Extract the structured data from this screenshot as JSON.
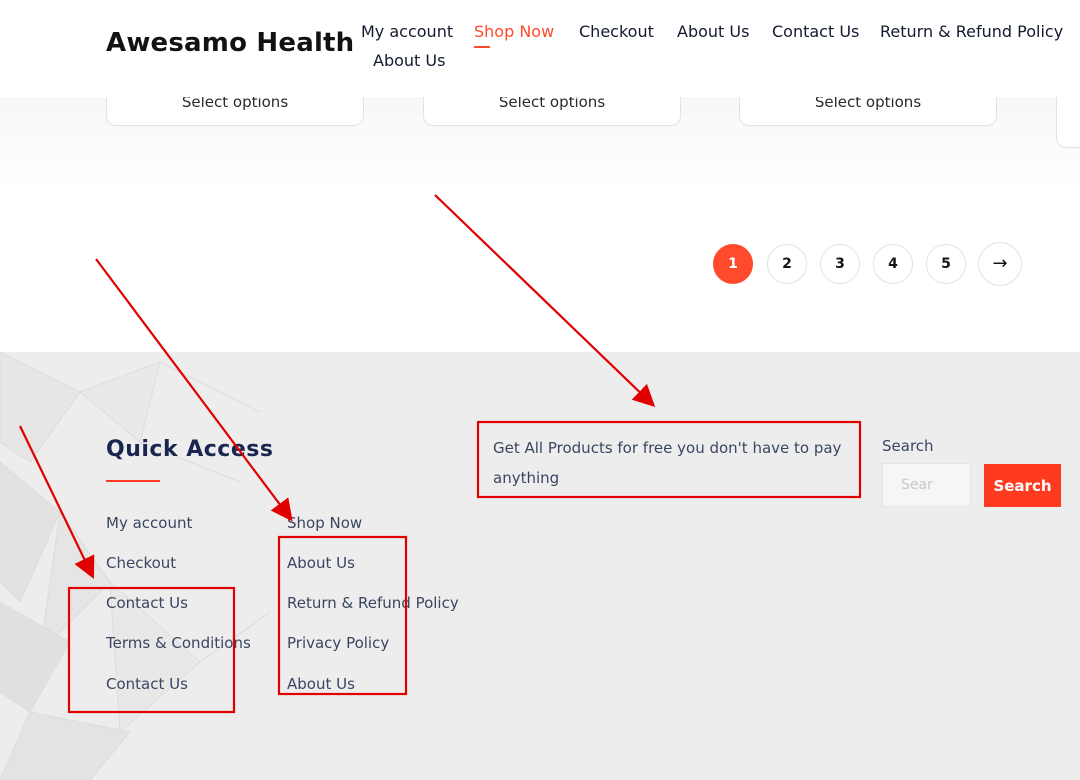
{
  "header": {
    "logo": "Awesamo Health",
    "nav": [
      "My account",
      "Shop Now",
      "Checkout",
      "About Us",
      "Contact Us",
      "Return & Refund Policy",
      "About Us"
    ],
    "active_item": "Shop Now"
  },
  "products": {
    "select_options_label": "Select options"
  },
  "pagination": {
    "pages": [
      "1",
      "2",
      "3",
      "4",
      "5"
    ],
    "current": "1",
    "next_icon": "→"
  },
  "footer": {
    "quick_access_title": "Quick Access",
    "col1": [
      "My account",
      "Checkout",
      "Contact Us",
      "Terms & Conditions",
      "Contact Us"
    ],
    "col2": [
      "Shop Now",
      "About Us",
      "Return & Refund Policy",
      "Privacy Policy",
      "About Us"
    ],
    "promo_text": "Get All Products for free you don't have to pay anything",
    "search_label": "Search",
    "search_placeholder": "Sear",
    "search_button": "Search"
  },
  "colors": {
    "accent": "#ff4a2c",
    "annotation": "#e00000",
    "footer_bg": "#ededed",
    "heading": "#1a2550"
  }
}
